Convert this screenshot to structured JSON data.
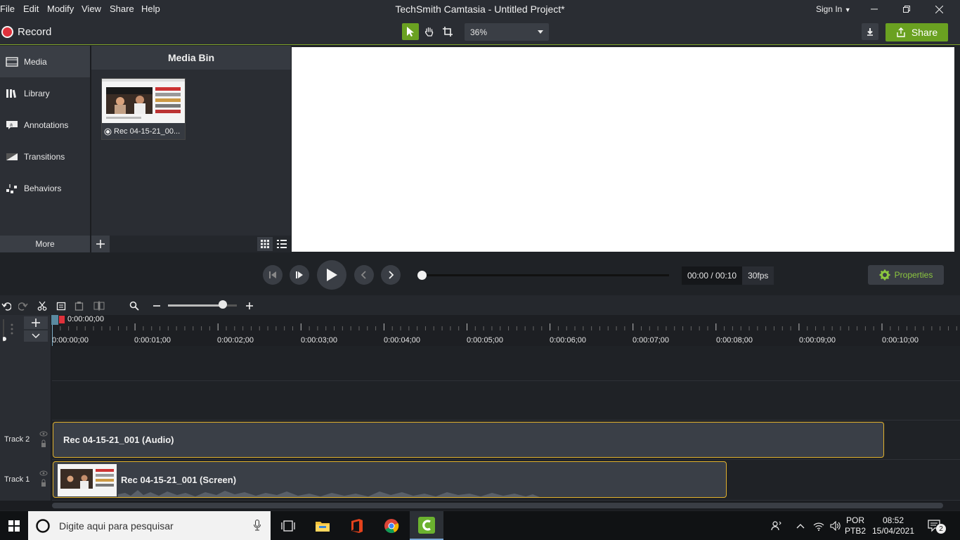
{
  "menu": {
    "items": [
      "File",
      "Edit",
      "Modify",
      "View",
      "Share",
      "Help"
    ],
    "title": "TechSmith Camtasia - Untitled Project*",
    "sign_in": "Sign In"
  },
  "toolbar": {
    "record_label": "Record",
    "zoom_value": "36%",
    "share_label": "Share"
  },
  "left_tabs": [
    {
      "label": "Media",
      "icon": "media-icon"
    },
    {
      "label": "Library",
      "icon": "library-icon"
    },
    {
      "label": "Annotations",
      "icon": "annotations-icon"
    },
    {
      "label": "Transitions",
      "icon": "transitions-icon"
    },
    {
      "label": "Behaviors",
      "icon": "behaviors-icon"
    }
  ],
  "more_label": "More",
  "media_bin": {
    "title": "Media Bin",
    "items": [
      {
        "name": "Rec 04-15-21_00..."
      }
    ]
  },
  "playback": {
    "time": "00:00 / 00:10",
    "fps": "30fps",
    "properties_label": "Properties"
  },
  "timeline": {
    "playhead_time": "0:00:00;00",
    "ruler_labels": [
      "0:00:00;00",
      "0:00:01;00",
      "0:00:02;00",
      "0:00:03;00",
      "0:00:04;00",
      "0:00:05;00",
      "0:00:06;00",
      "0:00:07;00",
      "0:00:08;00",
      "0:00:09;00",
      "0:00:10;00"
    ],
    "tracks": [
      {
        "label": "Track 2",
        "clip": "Rec 04-15-21_001 (Audio)"
      },
      {
        "label": "Track 1",
        "clip": "Rec 04-15-21_001 (Screen)"
      }
    ]
  },
  "taskbar": {
    "search_placeholder": "Digite aqui para pesquisar",
    "lang": "POR",
    "layout": "PTB2",
    "time": "08:52",
    "date": "15/04/2021",
    "notification_count": "2"
  },
  "colors": {
    "accent": "#6aa121",
    "record": "#e0313b",
    "clip_border": "#e1b12c"
  }
}
